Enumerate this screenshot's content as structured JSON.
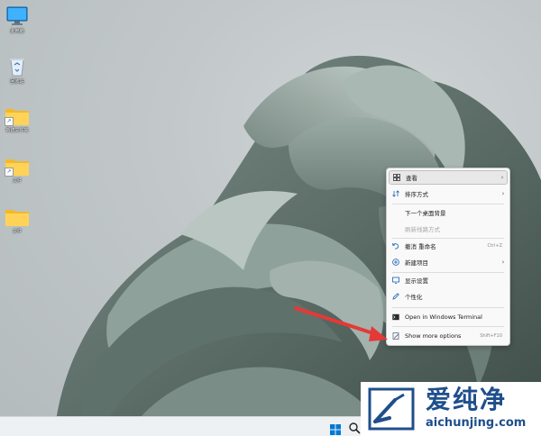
{
  "desktop_icons": [
    {
      "label": "此电脑",
      "icon": "monitor-icon"
    },
    {
      "label": "回收站",
      "icon": "recycle-bin-icon"
    },
    {
      "label": "新建文件夹",
      "icon": "folder-icon"
    },
    {
      "label": "文件",
      "icon": "folder-icon"
    },
    {
      "label": "文件",
      "icon": "folder-icon"
    }
  ],
  "context_menu": {
    "items": [
      {
        "label": "查看",
        "icon": "grid-icon",
        "submenu": "›"
      },
      {
        "label": "排序方式",
        "icon": "sort-icon",
        "submenu": "›"
      },
      {
        "label": "下一个桌面背景"
      },
      {
        "label": "刷新线路方式"
      },
      {
        "label": "撤消 重命名",
        "icon": "undo-icon",
        "shortcut": "Ctrl+Z"
      },
      {
        "label": "新建项目",
        "icon": "plus-circle-icon",
        "submenu": "›"
      },
      {
        "label": "显示设置",
        "icon": "display-icon"
      },
      {
        "label": "个性化",
        "icon": "pen-icon"
      },
      {
        "label": "Open in Windows Terminal",
        "icon": "terminal-icon"
      },
      {
        "label": "Show more options",
        "icon": "more-options-icon",
        "shortcut": "Shift+F10"
      }
    ]
  },
  "taskbar": {
    "start_icon": "windows-start-icon",
    "search_icon": "search-icon"
  },
  "watermark": {
    "chinese": "爱纯净",
    "url": "aichunjing.com"
  },
  "colors": {
    "accent": "#0078d4",
    "arrow": "#e53935",
    "watermark": "#1f4e8c"
  }
}
